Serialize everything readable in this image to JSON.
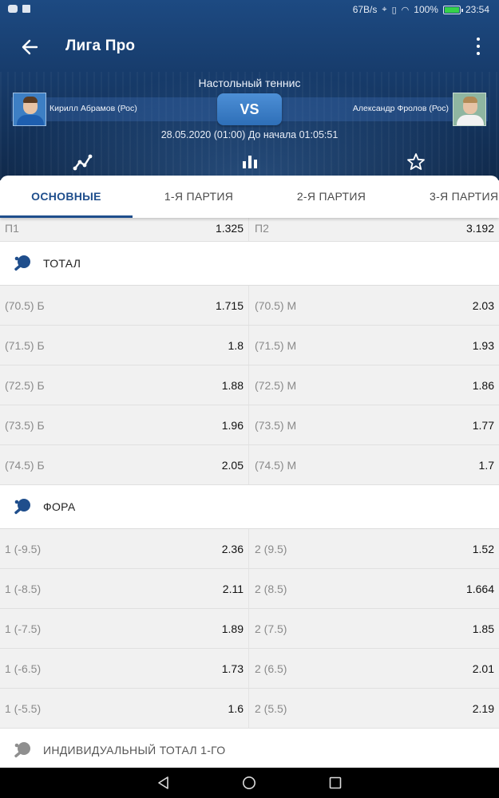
{
  "status_bar": {
    "speed": "67B/s",
    "battery": "100%",
    "time": "23:54"
  },
  "header": {
    "title": "Лига Про",
    "sport": "Настольный теннис",
    "player1": "Кирилл Абрамов (Рос)",
    "player2": "Александр Фролов (Рос)",
    "vs": "VS",
    "datetime": "28.05.2020 (01:00)  До начала 01:05:51",
    "icons": [
      "chart-line-icon",
      "bar-chart-icon",
      "star-icon"
    ]
  },
  "tabs": [
    "ОСНОВНЫЕ",
    "1-Я ПАРТИЯ",
    "2-Я ПАРТИЯ",
    "3-Я ПАРТИЯ"
  ],
  "top_row": {
    "l_label": "П1",
    "l_value": "1.325",
    "r_label": "П2",
    "r_value": "3.192"
  },
  "sections": [
    {
      "title": "ТОТАЛ",
      "rows": [
        {
          "l_label": "(70.5) Б",
          "l_value": "1.715",
          "r_label": "(70.5) М",
          "r_value": "2.03"
        },
        {
          "l_label": "(71.5) Б",
          "l_value": "1.8",
          "r_label": "(71.5) М",
          "r_value": "1.93"
        },
        {
          "l_label": "(72.5) Б",
          "l_value": "1.88",
          "r_label": "(72.5) М",
          "r_value": "1.86"
        },
        {
          "l_label": "(73.5) Б",
          "l_value": "1.96",
          "r_label": "(73.5) М",
          "r_value": "1.77"
        },
        {
          "l_label": "(74.5) Б",
          "l_value": "2.05",
          "r_label": "(74.5) М",
          "r_value": "1.7"
        }
      ]
    },
    {
      "title": "ФОРА",
      "rows": [
        {
          "l_label": "1 (-9.5)",
          "l_value": "2.36",
          "r_label": "2 (9.5)",
          "r_value": "1.52"
        },
        {
          "l_label": "1 (-8.5)",
          "l_value": "2.11",
          "r_label": "2 (8.5)",
          "r_value": "1.664"
        },
        {
          "l_label": "1 (-7.5)",
          "l_value": "1.89",
          "r_label": "2 (7.5)",
          "r_value": "1.85"
        },
        {
          "l_label": "1 (-6.5)",
          "l_value": "1.73",
          "r_label": "2 (6.5)",
          "r_value": "2.01"
        },
        {
          "l_label": "1 (-5.5)",
          "l_value": "1.6",
          "r_label": "2 (5.5)",
          "r_value": "2.19"
        }
      ]
    },
    {
      "title": "ИНДИВИДУАЛЬНЫЙ ТОТАЛ 1-ГО",
      "rows": []
    }
  ],
  "colors": {
    "accent": "#1f4e8c",
    "header_top": "#1d4a82",
    "header_bottom": "#10294a",
    "vs": "#3f82cb"
  }
}
